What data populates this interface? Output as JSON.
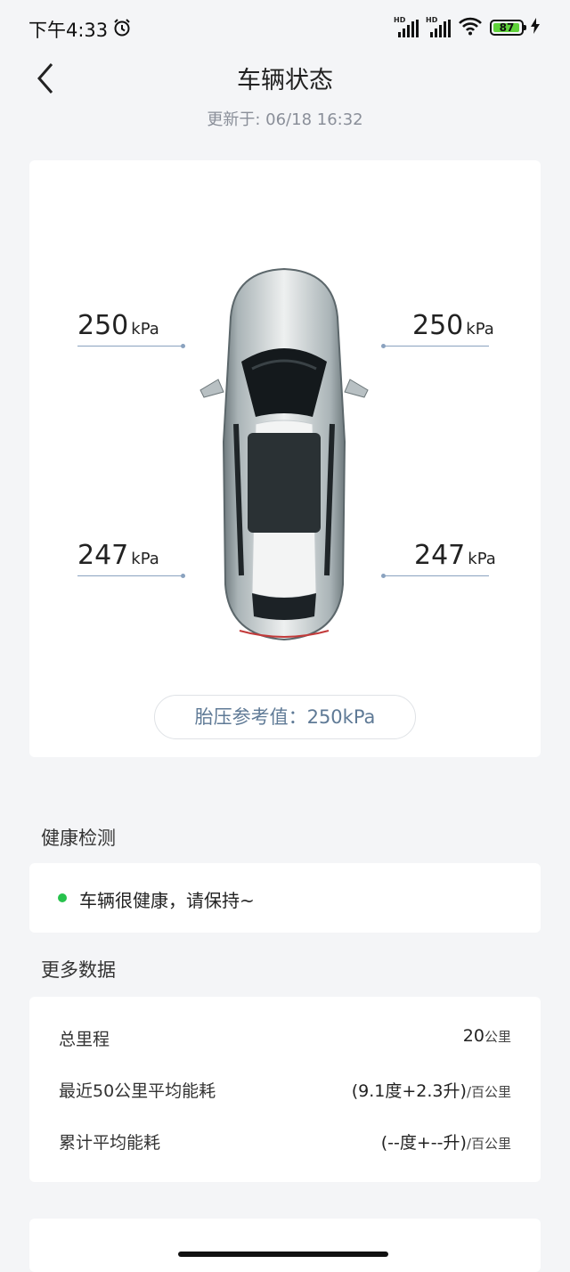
{
  "status_bar": {
    "time": "下午4:33",
    "battery": "87",
    "signal_hd_1": "HD",
    "signal_hd_2": "HD"
  },
  "header": {
    "title": "车辆状态"
  },
  "update_text": "更新于: 06/18 16:32",
  "tires": {
    "unit": "kPa",
    "front_left": "250",
    "front_right": "250",
    "rear_left": "247",
    "rear_right": "247",
    "reference": "胎压参考值：250kPa"
  },
  "health": {
    "section_title": "健康检测",
    "status_text": "车辆很健康，请保持~",
    "status_color": "#27c24c"
  },
  "more_data": {
    "section_title": "更多数据",
    "rows": [
      {
        "label": "总里程",
        "value": "20",
        "unit": "公里"
      },
      {
        "label": "最近50公里平均能耗",
        "value": "(9.1度+2.3升)",
        "unit": "/百公里"
      },
      {
        "label": "累计平均能耗",
        "value": "(--度+--升)",
        "unit": "/百公里"
      }
    ]
  },
  "icons": {
    "back": "chevron-left-icon",
    "alarm": "alarm-clock-icon",
    "wifi": "wifi-icon",
    "charging": "bolt-icon"
  }
}
